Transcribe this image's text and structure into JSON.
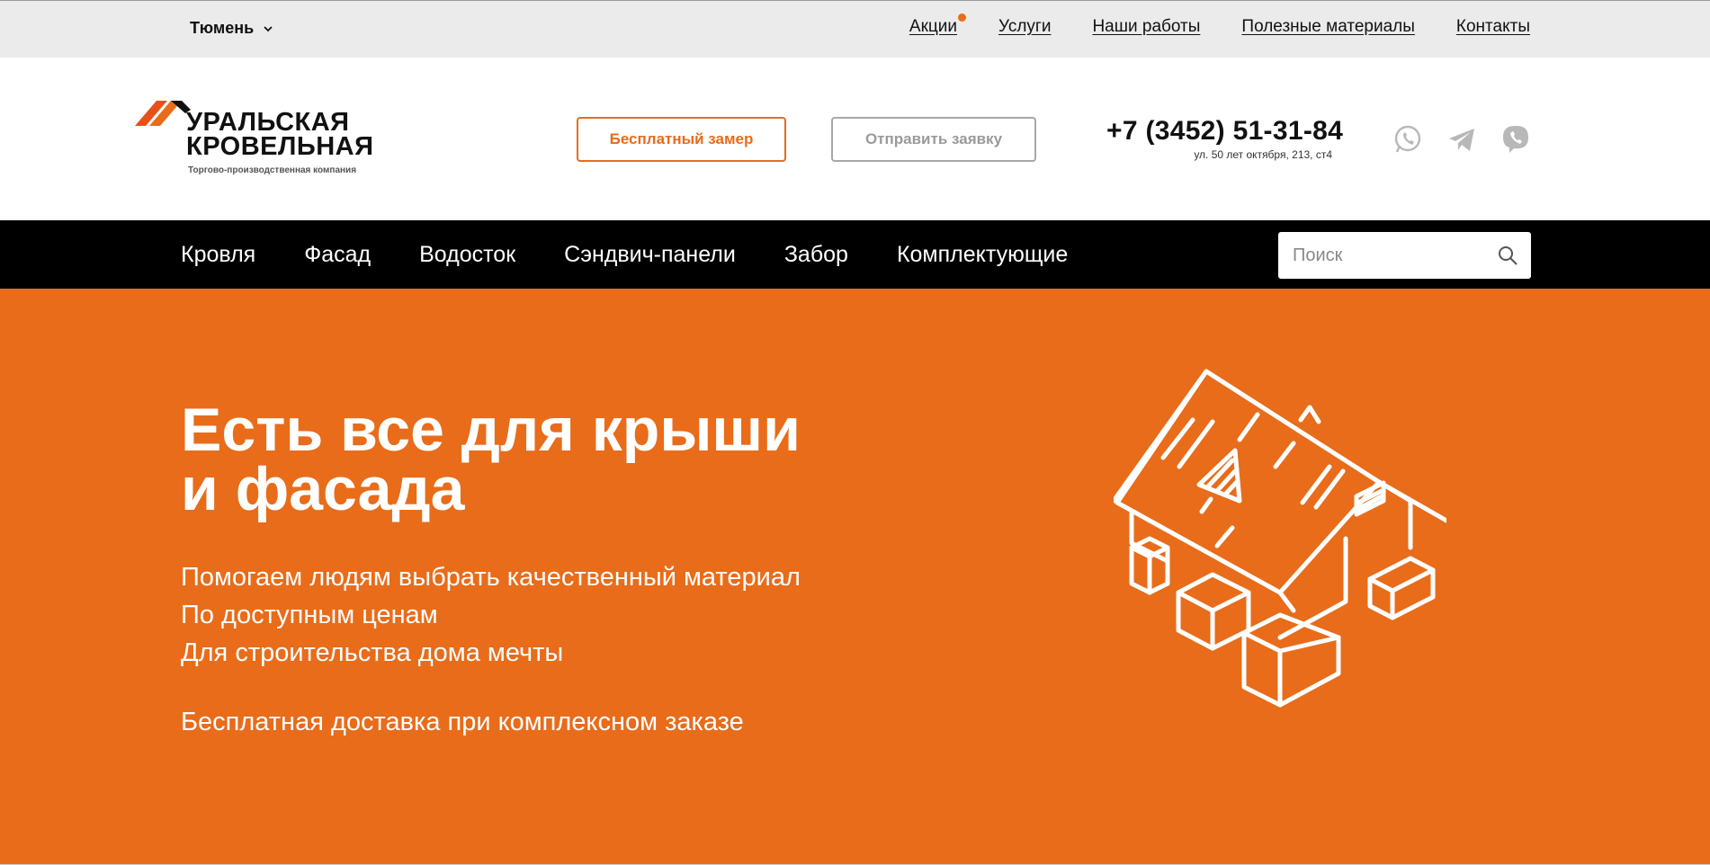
{
  "topbar": {
    "city": "Тюмень",
    "nav": [
      "Акции",
      "Услуги",
      "Наши работы",
      "Полезные материалы",
      "Контакты"
    ]
  },
  "header": {
    "logo_line1": "УРАЛЬСКАЯ",
    "logo_line2": "КРОВЕЛЬНАЯ",
    "logo_sub": "Торгово-производственная компания",
    "btn_measure": "Бесплатный замер",
    "btn_request": "Отправить заявку",
    "phone": "+7 (3452) 51-31-84",
    "address": "ул. 50 лет октября, 213, ст4",
    "messengers": [
      "whatsapp-icon",
      "telegram-icon",
      "viber-icon"
    ]
  },
  "mainnav": {
    "items": [
      "Кровля",
      "Фасад",
      "Водосток",
      "Сэндвич-панели",
      "Забор",
      "Комплектующие"
    ],
    "search_placeholder": "Поиск"
  },
  "hero": {
    "title_line1": "Есть все для крыши",
    "title_line2": "и фасада",
    "bullets": [
      "Помогаем людям выбрать качественный материал",
      "По доступным ценам",
      "Для строительства дома мечты"
    ],
    "delivery": "Бесплатная доставка при комплексном заказе"
  },
  "colors": {
    "accent": "#e86c1a",
    "topbar_bg": "#eaebea",
    "nav_bg": "#000000"
  }
}
